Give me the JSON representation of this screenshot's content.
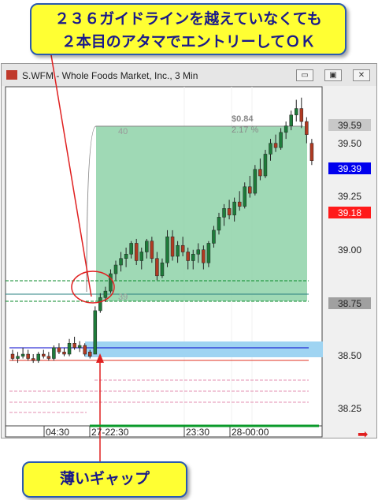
{
  "callouts": {
    "top_line1": "２３６ガイドラインを越えていなくても",
    "top_line2": "２本目のアタマでエントリーしてＯＫ",
    "bottom": "薄いギャップ"
  },
  "window": {
    "title": "S.WFM - Whole Foods Market, Inc., 3 Min",
    "btn_minimize": "▭",
    "btn_restore": "▣",
    "btn_close": "✕"
  },
  "chart": {
    "pnl_value": "$0.84",
    "pnl_percent": "2.17 %",
    "trade_label_top": "40",
    "trade_label_bottom": "39",
    "colors": {
      "up": "#1e7b3a",
      "down": "#b03a22",
      "box": "#7fcc9c",
      "gap": "#9fd4f2",
      "ask": "#0000ee",
      "bid": "#ff1a1a"
    }
  },
  "price_axis": {
    "ticks": [
      "39.50",
      "39.25",
      "39.00",
      "38.50",
      "38.25"
    ],
    "highlight_high": "39.59",
    "highlight_ask": "39.39",
    "highlight_bid": "39.18",
    "highlight_entry": "38.75"
  },
  "time_axis": {
    "labels": [
      "04:30",
      "27-22:30",
      "23:30",
      "28-00:00"
    ]
  },
  "chart_data": {
    "type": "candlestick",
    "series": [
      {
        "values": [
          [
            38.51,
            38.53,
            38.48,
            38.49
          ],
          [
            38.49,
            38.52,
            38.47,
            38.5
          ],
          [
            38.5,
            38.54,
            38.49,
            38.51
          ],
          [
            38.51,
            38.53,
            38.48,
            38.49
          ],
          [
            38.49,
            38.51,
            38.47,
            38.48
          ],
          [
            38.48,
            38.52,
            38.47,
            38.51
          ],
          [
            38.51,
            38.53,
            38.49,
            38.5
          ],
          [
            38.5,
            38.52,
            38.48,
            38.49
          ],
          [
            38.49,
            38.55,
            38.48,
            38.54
          ],
          [
            38.54,
            38.56,
            38.51,
            38.52
          ],
          [
            38.52,
            38.54,
            38.5,
            38.51
          ],
          [
            38.51,
            38.58,
            38.5,
            38.56
          ],
          [
            38.56,
            38.59,
            38.53,
            38.54
          ],
          [
            38.54,
            38.57,
            38.52,
            38.55
          ],
          [
            38.55,
            38.56,
            38.5,
            38.51
          ],
          [
            38.52,
            38.53,
            38.49,
            38.5
          ],
          [
            38.51,
            38.73,
            38.52,
            38.71
          ],
          [
            38.71,
            38.79,
            38.7,
            38.77
          ],
          [
            38.77,
            38.82,
            38.75,
            38.8
          ],
          [
            38.8,
            38.9,
            38.79,
            38.88
          ],
          [
            38.88,
            38.94,
            38.85,
            38.92
          ],
          [
            38.92,
            38.98,
            38.89,
            38.95
          ],
          [
            38.95,
            39.0,
            38.91,
            38.97
          ],
          [
            38.97,
            39.03,
            38.95,
            39.02
          ],
          [
            39.02,
            39.04,
            38.92,
            38.94
          ],
          [
            38.94,
            39.0,
            38.9,
            38.98
          ],
          [
            38.98,
            39.04,
            38.95,
            39.03
          ],
          [
            39.03,
            39.05,
            38.93,
            38.95
          ],
          [
            38.95,
            38.98,
            38.85,
            38.87
          ],
          [
            38.87,
            38.95,
            38.86,
            38.93
          ],
          [
            38.93,
            39.08,
            38.91,
            39.05
          ],
          [
            39.05,
            39.08,
            38.94,
            38.96
          ],
          [
            38.96,
            39.03,
            38.93,
            39.01
          ],
          [
            39.01,
            39.05,
            38.96,
            38.98
          ],
          [
            38.98,
            39.0,
            38.9,
            38.94
          ],
          [
            38.94,
            38.99,
            38.9,
            38.97
          ],
          [
            38.97,
            39.02,
            38.93,
            38.99
          ],
          [
            38.99,
            39.01,
            38.9,
            38.93
          ],
          [
            38.93,
            39.03,
            38.91,
            39.02
          ],
          [
            39.02,
            39.1,
            39.0,
            39.08
          ],
          [
            39.08,
            39.16,
            39.06,
            39.14
          ],
          [
            39.14,
            39.2,
            39.1,
            39.18
          ],
          [
            39.18,
            39.22,
            39.13,
            39.15
          ],
          [
            39.15,
            39.23,
            39.12,
            39.21
          ],
          [
            39.21,
            39.26,
            39.17,
            39.19
          ],
          [
            39.19,
            39.3,
            39.18,
            39.28
          ],
          [
            39.28,
            39.33,
            39.23,
            39.25
          ],
          [
            39.25,
            39.38,
            39.24,
            39.36
          ],
          [
            39.36,
            39.41,
            39.31,
            39.33
          ],
          [
            39.33,
            39.45,
            39.32,
            39.43
          ],
          [
            39.43,
            39.5,
            39.4,
            39.48
          ],
          [
            39.48,
            39.52,
            39.44,
            39.46
          ],
          [
            39.46,
            39.55,
            39.45,
            39.53
          ],
          [
            39.53,
            39.58,
            39.5,
            39.56
          ],
          [
            39.56,
            39.63,
            39.54,
            39.61
          ],
          [
            39.61,
            39.68,
            39.58,
            39.64
          ],
          [
            39.64,
            39.69,
            39.55,
            39.58
          ],
          [
            39.58,
            39.6,
            39.48,
            39.52
          ],
          [
            39.48,
            39.5,
            39.38,
            39.4
          ]
        ]
      }
    ],
    "ylim": [
      38.18,
      39.74
    ]
  }
}
